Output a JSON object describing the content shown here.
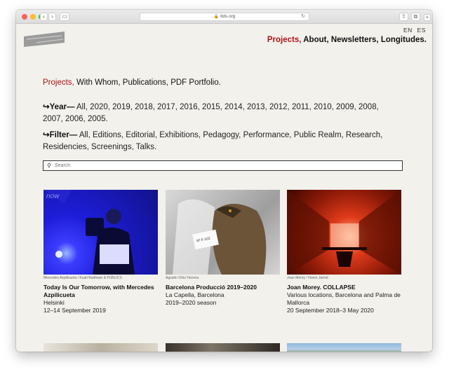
{
  "browser": {
    "url": "ltds.org"
  },
  "header": {
    "lang": [
      "EN",
      "ES"
    ],
    "nav": [
      "Projects,",
      "About,",
      "Newsletters,",
      "Longitudes."
    ]
  },
  "subnav": [
    "Projects,",
    "With Whom,",
    "Publications,",
    "PDF Portfolio."
  ],
  "year_filter": {
    "label": "↪Year—",
    "items": "All, 2020, 2019, 2018, 2017, 2016, 2015, 2014, 2013, 2012, 2011, 2010, 2009, 2008, 2007, 2006, 2005."
  },
  "type_filter": {
    "label": "↪Filter—",
    "items": "All, Editions, Editorial, Exhibitions, Pedagogy, Performance, Public Realm, Research, Residencies, Screenings, Talks."
  },
  "search": {
    "placeholder": "Search"
  },
  "projects": [
    {
      "caption": "Mercedes Azpilicueta / Kuati Radhwar & PUBLICS",
      "title": "Today Is Our Tomorrow, with Mercedes Azpilicueta",
      "location": "Helsinki",
      "date": "12–14 September 2019"
    },
    {
      "caption": "Agustín Ortiz Herrera",
      "title": "Barcelona Producció 2019–2020",
      "location": "La Capella, Barcelona",
      "date": "2019–2020 season"
    },
    {
      "caption": "Joan Morey / Noem Jariod",
      "title": "Joan Morey. COLLAPSE",
      "location": "Various locations, Barcelona and Palma de Mallorca",
      "date": "20 September 2018–3 May 2020"
    }
  ]
}
